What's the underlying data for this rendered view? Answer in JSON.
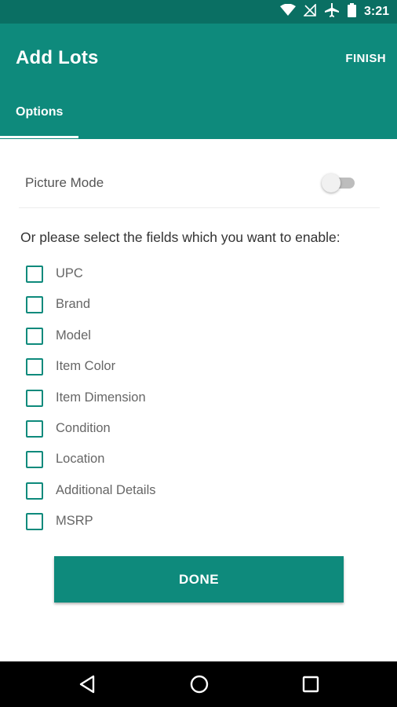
{
  "status_bar": {
    "time": "3:21",
    "icons": [
      "wifi-icon",
      "no-signal-icon",
      "airplane-mode-icon",
      "battery-icon"
    ]
  },
  "app_bar": {
    "title": "Add Lots",
    "action_label": "FINISH",
    "tabs": [
      {
        "label": "Options",
        "selected": true
      }
    ]
  },
  "picture_mode": {
    "label": "Picture Mode",
    "enabled": false
  },
  "fields_prompt": "Or please select the fields which you want to enable:",
  "fields": [
    {
      "label": "UPC",
      "checked": false
    },
    {
      "label": "Brand",
      "checked": false
    },
    {
      "label": "Model",
      "checked": false
    },
    {
      "label": "Item Color",
      "checked": false
    },
    {
      "label": "Item Dimension",
      "checked": false
    },
    {
      "label": "Condition",
      "checked": false
    },
    {
      "label": "Location",
      "checked": false
    },
    {
      "label": "Additional Details",
      "checked": false
    },
    {
      "label": "MSRP",
      "checked": false
    }
  ],
  "done_label": "DONE",
  "nav_bar": {
    "icons": [
      "back-icon",
      "home-icon",
      "recents-icon"
    ]
  },
  "colors": {
    "accent": "#0e8a7c",
    "status_bar": "#0a6f63",
    "nav_bar": "#000000"
  }
}
